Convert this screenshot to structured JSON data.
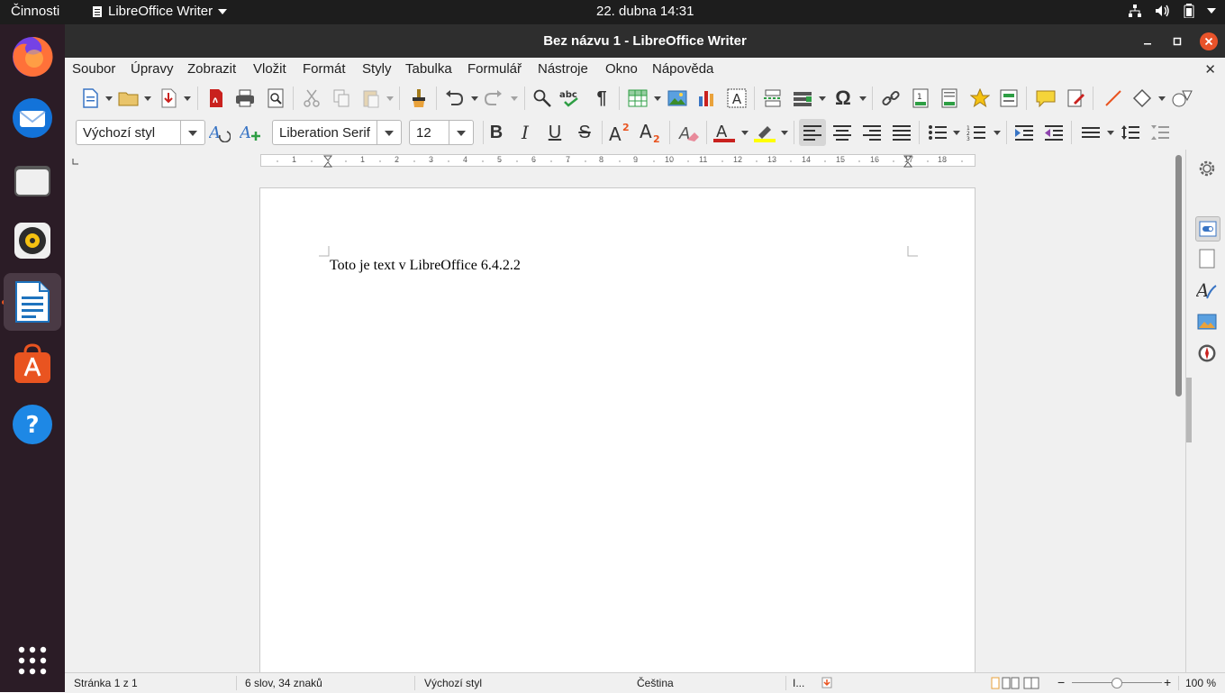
{
  "topbar": {
    "activities": "Činnosti",
    "app_menu": "LibreOffice Writer",
    "clock": "22. dubna  14:31"
  },
  "dock": {
    "items": [
      {
        "name": "firefox-icon"
      },
      {
        "name": "thunderbird-icon"
      },
      {
        "name": "files-icon"
      },
      {
        "name": "rhythmbox-icon"
      },
      {
        "name": "libreoffice-writer-icon",
        "active": true
      },
      {
        "name": "software-center-icon"
      },
      {
        "name": "help-icon"
      },
      {
        "name": "show-applications-icon"
      }
    ]
  },
  "window": {
    "title": "Bez názvu 1 - LibreOffice Writer"
  },
  "menubar": {
    "items": [
      "Soubor",
      "Úpravy",
      "Zobrazit",
      "Vložit",
      "Formát",
      "Styly",
      "Tabulka",
      "Formulář",
      "Nástroje",
      "Okno",
      "Nápověda"
    ]
  },
  "formatting": {
    "paragraph_style": "Výchozí styl",
    "font_name": "Liberation Serif",
    "font_size": "12"
  },
  "ruler": {
    "numbers": [
      "1",
      "1",
      "2",
      "3",
      "4",
      "5",
      "6",
      "7",
      "8",
      "9",
      "10",
      "11",
      "12",
      "13",
      "14",
      "15",
      "16",
      "17",
      "18"
    ]
  },
  "document": {
    "text": "Toto je text v LibreOffice 6.4.2.2"
  },
  "statusbar": {
    "page": "Stránka 1 z 1",
    "words": "6 slov, 34 znaků",
    "page_style": "Výchozí styl",
    "language": "Čeština",
    "insert_mode": "I...",
    "zoom_minus": "−",
    "zoom_plus": "+",
    "zoom": "100 %"
  },
  "colors": {
    "ubuntu_orange": "#e95420",
    "font_color_red": "#c9211e",
    "highlight_yellow": "#ffff00"
  }
}
